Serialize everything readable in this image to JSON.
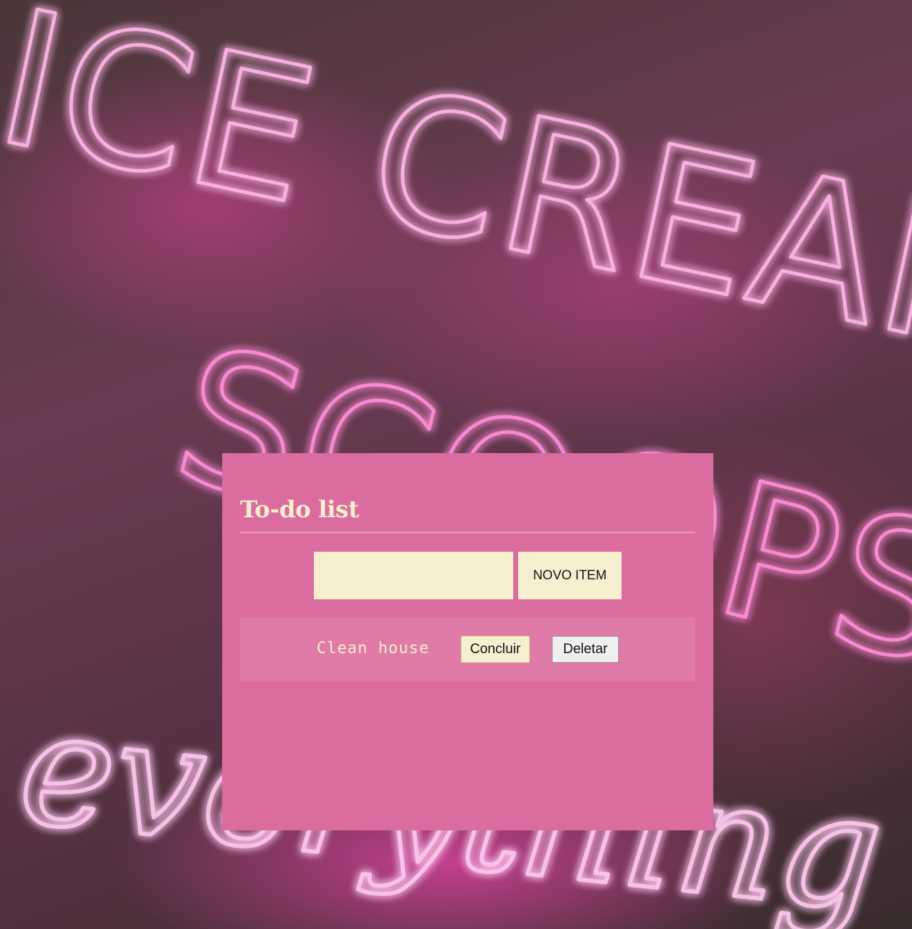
{
  "app": {
    "title": "To-do list",
    "new_item_input": {
      "value": "",
      "placeholder": ""
    },
    "new_item_button": "NOVO ITEM",
    "items": [
      {
        "text": "Clean house",
        "complete_label": "Concluir",
        "delete_label": "Deletar"
      }
    ]
  },
  "background_image": {
    "description_icon": "neon-sign-background",
    "neon_text": [
      "ICE CREAM",
      "SCOOPS",
      "everything"
    ]
  },
  "colors": {
    "card": "#db6c9f",
    "item_row": "#e07aa7",
    "cream": "#f6efcf",
    "neon_pink": "#ff5fc4"
  }
}
